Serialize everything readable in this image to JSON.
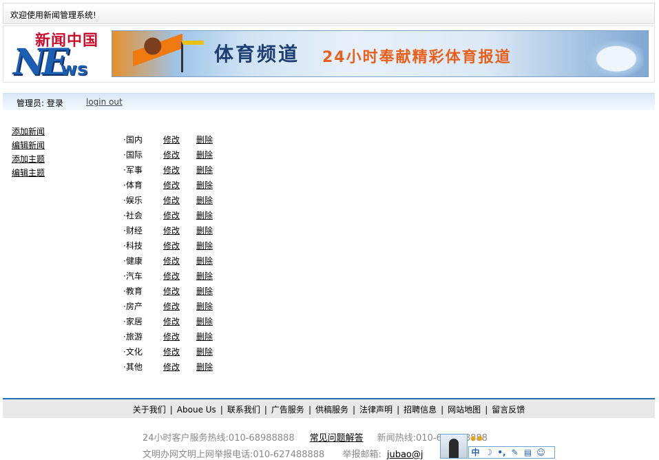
{
  "welcome_text": "欢迎使用新闻管理系统!",
  "logo": {
    "cn": "新闻中国",
    "ne": "NE",
    "ws": "ws"
  },
  "banner": {
    "title1": "体育频道",
    "title2": "24小时奉献精彩体育报道"
  },
  "admin": {
    "label": "管理员:  登录",
    "logout": "login out"
  },
  "leftnav": [
    "添加新闻",
    "编辑新闻",
    "添加主题",
    "编辑主题"
  ],
  "topics": [
    "·国内",
    "·国际",
    "·军事",
    "·体育",
    "·娱乐",
    "·社会",
    "·财经",
    "·科技",
    "·健康",
    "·汽车",
    "·教育",
    "·房产",
    "·家居",
    "·旅游",
    "·文化",
    "·其他"
  ],
  "topic_edit": "修改",
  "topic_delete": "删除",
  "footer_nav": [
    "关于我们",
    "Aboue Us",
    "联系我们",
    "广告服务",
    "供稿服务",
    "法律声明",
    "招聘信息",
    "网站地图",
    "留言反馈"
  ],
  "footer": {
    "hotline": "24小时客户服务热线:010-68988888",
    "faq": "常见问题解答",
    "news_hotline": "新闻热线:010-627488888",
    "report_phone": "文明办网文明上网举报电话:010-627488888",
    "report_mail_label": "举报邮箱:",
    "report_mail": "jubao@j"
  },
  "ime": {
    "icons": [
      "中",
      "☽",
      "•,",
      "✎",
      "▤",
      "☺"
    ],
    "suns": "✹✹"
  }
}
